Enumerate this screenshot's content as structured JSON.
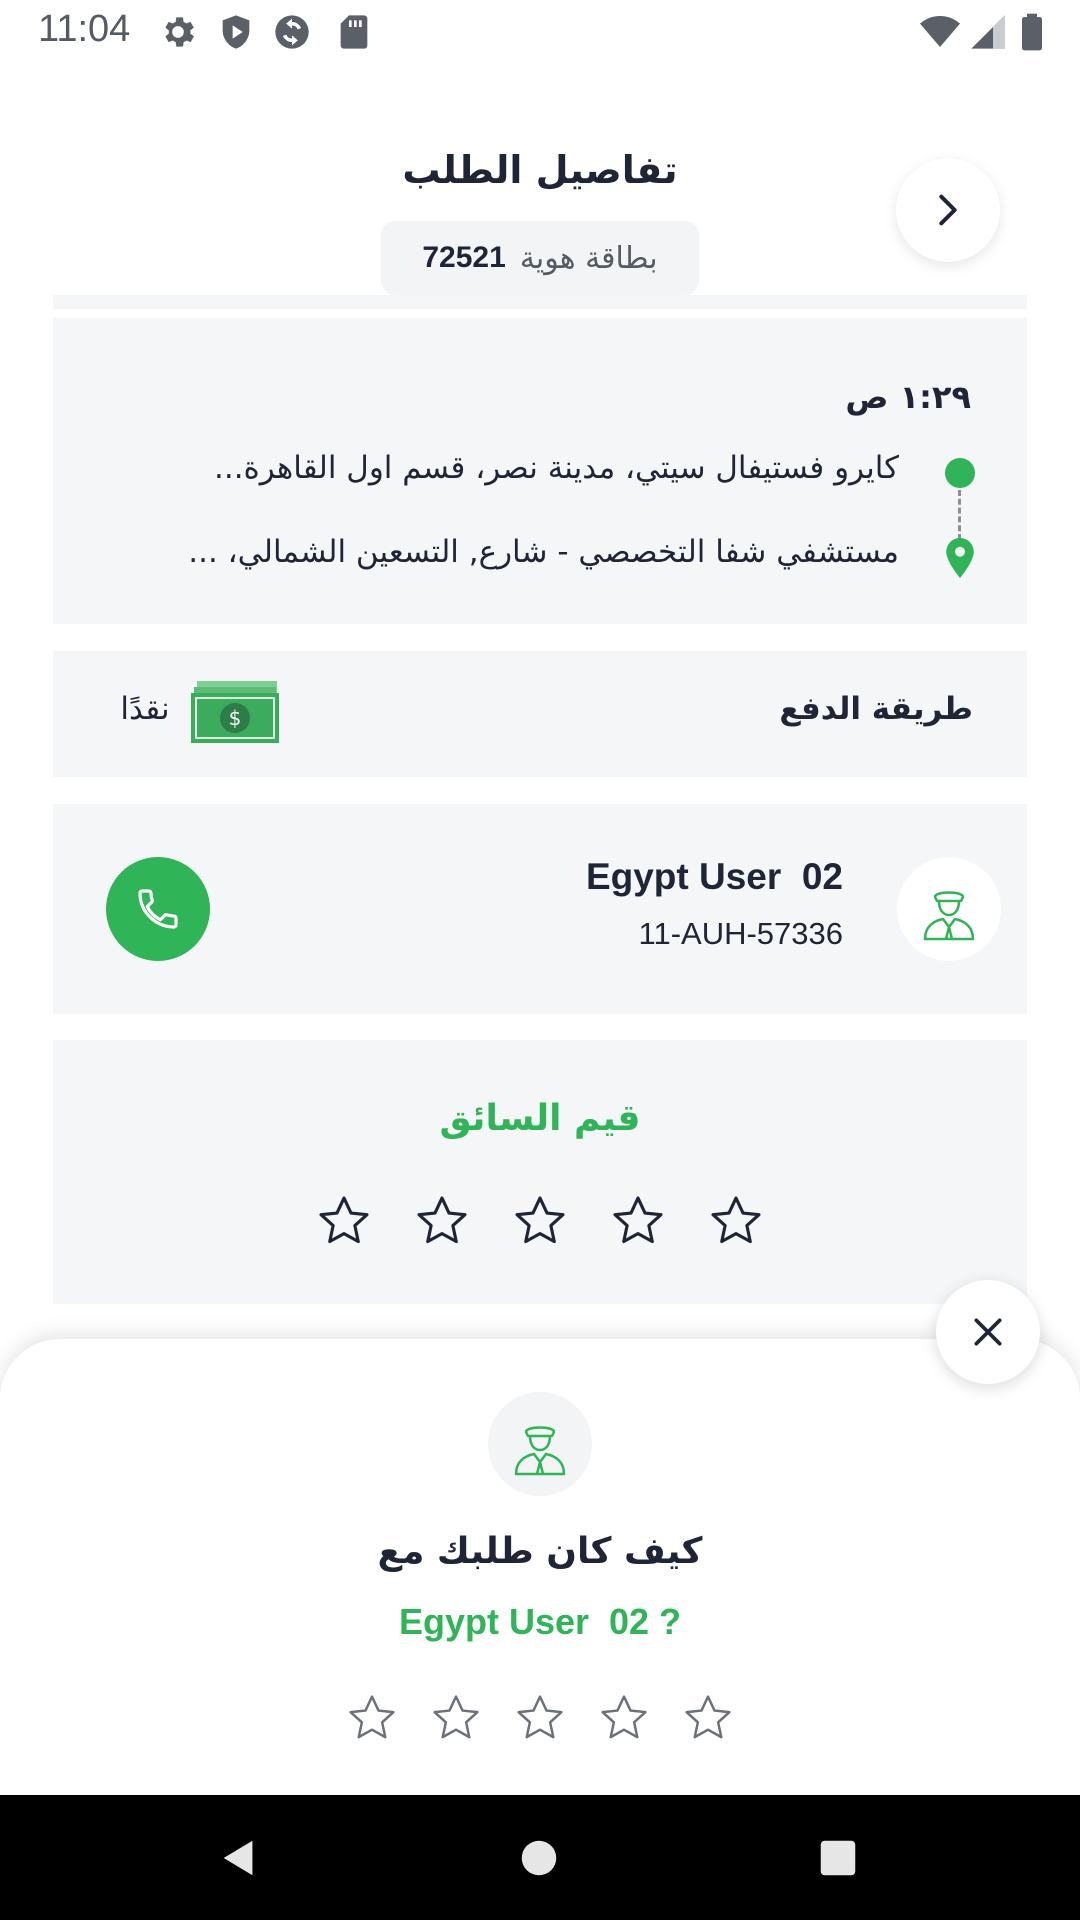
{
  "status_bar": {
    "time": "11:04",
    "left_icons": [
      "settings-icon",
      "shield-play-icon",
      "sync-icon",
      "sd-card-icon"
    ],
    "right_icons": [
      "wifi-icon",
      "signal-icon",
      "battery-icon"
    ]
  },
  "header": {
    "title": "تفاصيل الطلب",
    "back_icon": "chevron-right-icon",
    "id_label": "بطاقة هوية",
    "id_number": "72521"
  },
  "trip": {
    "time": "١:٢٩ ص",
    "pickup": "كايرو فستيفال سيتي، مدينة نصر، قسم اول القاهرة...",
    "dropoff": "مستشفي شفا التخصصي - شارع, التسعين الشمالي، ..."
  },
  "payment": {
    "label": "طريقة الدفع",
    "method": "نقدًا",
    "icon": "cash-icon"
  },
  "driver": {
    "name": "Egypt User  02",
    "plate": "11-AUH-57336",
    "avatar_icon": "driver-avatar-icon",
    "call_icon": "phone-icon"
  },
  "rate_driver": {
    "title": "قيم السائق",
    "stars_total": 5,
    "rating": 0
  },
  "rating_sheet": {
    "question": "كيف كان طلبك مع",
    "driver_name": "Egypt User  02 ?",
    "stars_total": 5,
    "rating": 0,
    "close_icon": "close-icon"
  },
  "colors": {
    "accent_green": "#2fb457",
    "text_dark": "#1f2537",
    "card_bg": "#f5f6f8"
  }
}
